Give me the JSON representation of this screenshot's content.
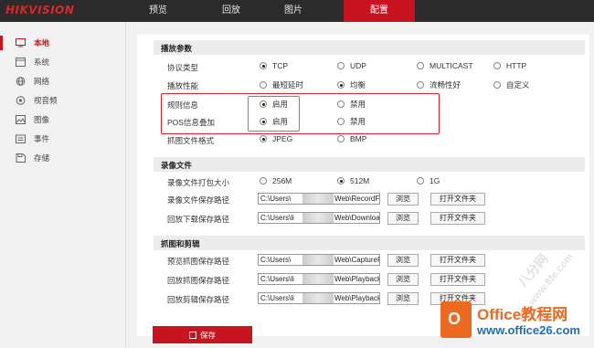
{
  "brand": {
    "logo": "HIKVISION"
  },
  "nav": {
    "tabs": [
      "预览",
      "回放",
      "图片",
      "配置"
    ],
    "active": "配置"
  },
  "sidebar": {
    "items": [
      {
        "label": "本地",
        "icon": "monitor-icon",
        "active": true
      },
      {
        "label": "系统",
        "icon": "system-icon",
        "active": false
      },
      {
        "label": "网络",
        "icon": "globe-icon",
        "active": false
      },
      {
        "label": "视音频",
        "icon": "audio-video-icon",
        "active": false
      },
      {
        "label": "图像",
        "icon": "image-icon",
        "active": false
      },
      {
        "label": "事件",
        "icon": "event-icon",
        "active": false
      },
      {
        "label": "存储",
        "icon": "storage-icon",
        "active": false
      }
    ]
  },
  "playback_params": {
    "title": "播放参数",
    "protocol": {
      "label": "协议类型",
      "options": [
        "TCP",
        "UDP",
        "MULTICAST",
        "HTTP"
      ],
      "selected": "TCP"
    },
    "performance": {
      "label": "播放性能",
      "options": [
        "最短延时",
        "均衡",
        "流畅性好",
        "自定义"
      ],
      "selected": "均衡"
    },
    "rules": {
      "label": "规则信息",
      "options": [
        "启用",
        "禁用"
      ],
      "selected": "启用"
    },
    "pos": {
      "label": "POS信息叠加",
      "options": [
        "启用",
        "禁用"
      ],
      "selected": "启用"
    },
    "snapshot_format": {
      "label": "抓图文件格式",
      "options": [
        "JPEG",
        "BMP"
      ],
      "selected": "JPEG"
    }
  },
  "record_files": {
    "title": "录像文件",
    "pack_size": {
      "label": "录像文件打包大小",
      "options": [
        "256M",
        "512M",
        "1G"
      ],
      "selected": "512M"
    },
    "save_path": {
      "label": "录像文件保存路径",
      "left": "C:\\Users\\",
      "right": "Web\\RecordFile",
      "browse": "浏览",
      "open": "打开文件夹"
    },
    "download_path": {
      "label": "回放下载保存路径",
      "left": "C:\\Users\\li",
      "right": "Web\\DownloadF",
      "browse": "浏览",
      "open": "打开文件夹"
    }
  },
  "snap_clip": {
    "title": "抓图和剪辑",
    "preview_snap": {
      "label": "预览抓图保存路径",
      "left": "C:\\Users\\",
      "right": "Web\\CaptureFile",
      "browse": "浏览",
      "open": "打开文件夹"
    },
    "playback_snap": {
      "label": "回放抓图保存路径",
      "left": "C:\\Users\\li",
      "right": "Web\\PlaybackP",
      "browse": "浏览",
      "open": "打开文件夹"
    },
    "playback_clip": {
      "label": "回放剪辑保存路径",
      "left": "C:\\Users\\li",
      "right": "Web\\PlaybackF",
      "browse": "浏览",
      "open": "打开文件夹"
    }
  },
  "actions": {
    "save": "保存"
  },
  "watermark": {
    "diag1": "八分网",
    "diag2": "www.8fe.com",
    "brand_glyph": "O",
    "brand_name": "Office教程网",
    "brand_url": "www.office26.com"
  },
  "colors": {
    "accent": "#c8141e",
    "highlight_red": "#e0232b",
    "highlight_green": "#2fbf2f"
  }
}
